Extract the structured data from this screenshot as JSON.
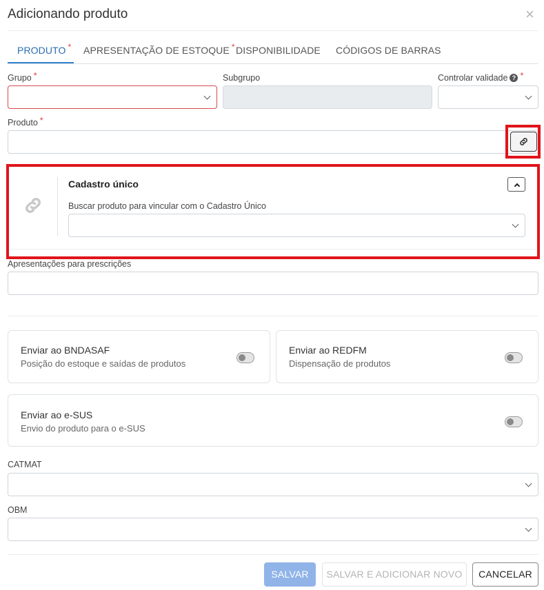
{
  "dialog": {
    "title": "Adicionando produto",
    "close_label": "×"
  },
  "tabs": [
    {
      "label": "PRODUTO",
      "required": "*"
    },
    {
      "label": "APRESENTAÇÃO DE ESTOQUE",
      "required": "*"
    },
    {
      "label": "DISPONIBILIDADE"
    },
    {
      "label": "CÓDIGOS DE BARRAS"
    }
  ],
  "form": {
    "grupo": {
      "label": "Grupo",
      "required": "*",
      "value": ""
    },
    "subgrupo": {
      "label": "Subgrupo",
      "value": ""
    },
    "controlar_validade": {
      "label": "Controlar validade",
      "required": "*",
      "help": "?",
      "value": ""
    },
    "produto": {
      "label": "Produto",
      "required": "*",
      "value": ""
    },
    "apresentacoes": {
      "label": "Apresentações para prescrições",
      "value": ""
    },
    "catmat": {
      "label": "CATMAT",
      "value": ""
    },
    "obm": {
      "label": "OBM",
      "value": ""
    }
  },
  "cadastro_unico": {
    "title": "Cadastro único",
    "search_label": "Buscar produto para vincular com o Cadastro Único",
    "search_value": ""
  },
  "integrations": [
    {
      "title": "Enviar ao BNDASAF",
      "subtitle": "Posição do estoque e saídas de produtos",
      "enabled": false
    },
    {
      "title": "Enviar ao REDFM",
      "subtitle": "Dispensação de produtos",
      "enabled": false
    },
    {
      "title": "Enviar ao e-SUS",
      "subtitle": "Envio do produto para o e-SUS",
      "enabled": false
    }
  ],
  "footer": {
    "save_label": "SALVAR",
    "save_add_label": "SALVAR E ADICIONAR NOVO",
    "cancel_label": "CANCELAR"
  },
  "colors": {
    "accent": "#2b6cb0",
    "required": "#e53e3e",
    "highlight": "#e0141b",
    "primary_disabled": "#90b4e8"
  },
  "icons": {
    "link": "link-icon",
    "close": "close-icon",
    "chevron": "chevron-down-icon",
    "collapse": "chevron-up-icon"
  }
}
